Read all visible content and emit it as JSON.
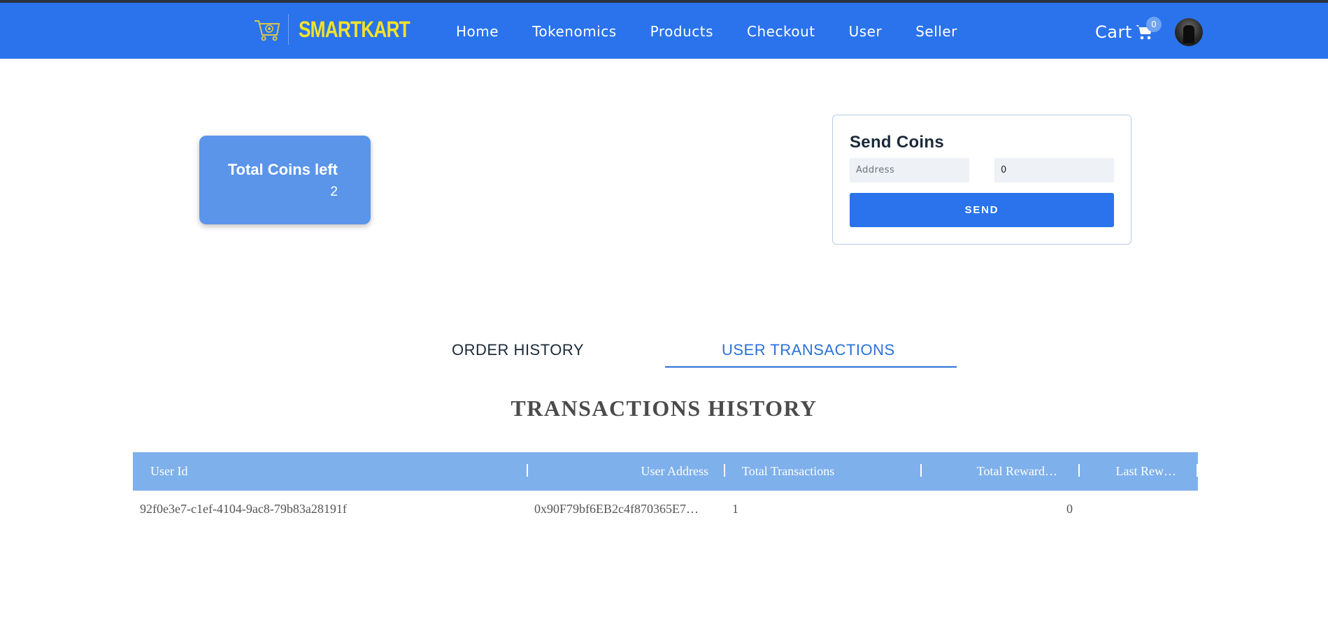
{
  "header": {
    "brand": "SMARTKART",
    "nav": [
      "Home",
      "Tokenomics",
      "Products",
      "Checkout",
      "User",
      "Seller"
    ],
    "cart_label": "Cart",
    "cart_count": "0"
  },
  "coins_card": {
    "title": "Total Coins left",
    "value": "2"
  },
  "send_coins": {
    "title": "Send Coins",
    "address_placeholder": "Address",
    "amount_value": "0",
    "button_label": "SEND"
  },
  "tabs": {
    "order_history": "ORDER HISTORY",
    "user_transactions": "USER TRANSACTIONS",
    "active": "user_transactions"
  },
  "transactions": {
    "title": "TRANSACTIONS HISTORY",
    "columns": [
      "User Id",
      "User Address",
      "Total Transactions",
      "Total Reward…",
      "Last Rew…"
    ],
    "rows": [
      [
        "92f0e3e7-c1ef-4104-9ac8-79b83a28191f",
        "0x90F79bf6EB2c4f870365E7…",
        "1",
        "0",
        ""
      ]
    ]
  },
  "colors": {
    "navbar": "#2a73ec",
    "brand_text": "#f2e22a",
    "card": "#5a95ea",
    "table_header": "#7eb0eb",
    "active_tab": "#2a73d8"
  },
  "icons": [
    "shopping-cart-logo-icon",
    "shopping-cart-icon",
    "user-avatar"
  ]
}
